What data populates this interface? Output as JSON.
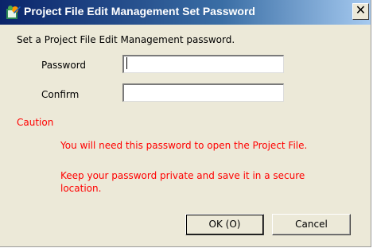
{
  "dialog": {
    "title": "Project File Edit Management Set Password",
    "close_label": "✕",
    "instruction": "Set a Project File Edit Management  password."
  },
  "form": {
    "password_label": "Password",
    "password_value": "",
    "confirm_label": "Confirm",
    "confirm_value": ""
  },
  "caution": {
    "heading": "Caution",
    "line1": "You will need this password to open the Project File.",
    "line2a": "Keep your password private and save it in a secure",
    "line2b": "location."
  },
  "buttons": {
    "ok_label": "OK (O)",
    "cancel_label": "Cancel"
  },
  "icons": {
    "title_icon": "project-file-icon",
    "close_icon": "close-icon"
  }
}
